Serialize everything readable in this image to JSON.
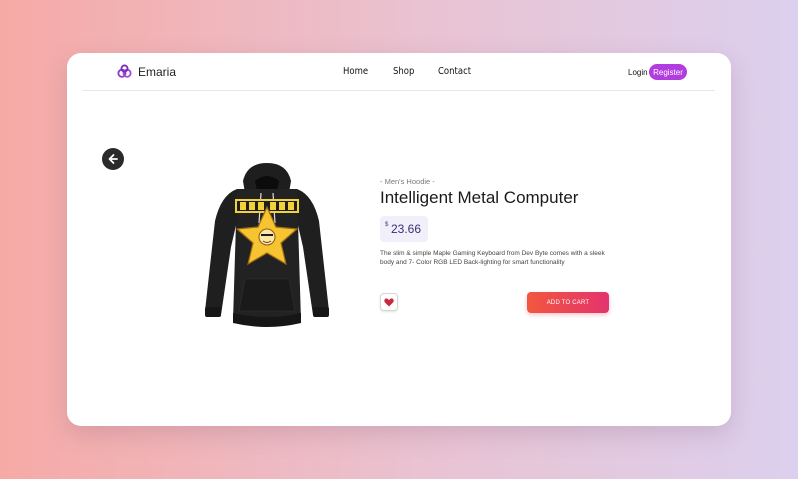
{
  "brand": {
    "name": "Emaria",
    "logo_icon": "interlocking-rings-logo",
    "logo_color": "#8e3bc8"
  },
  "nav": {
    "items": [
      {
        "label": "Home"
      },
      {
        "label": "Shop"
      },
      {
        "label": "Contact"
      }
    ]
  },
  "auth": {
    "login_label": "Login",
    "register_label": "Register",
    "register_color": "#b13cdf"
  },
  "back_button": {
    "icon": "arrow-left-icon"
  },
  "product": {
    "image": "black-hoodie-star-print",
    "category": "- Men's Hoodie -",
    "title": "Intelligent Metal Computer",
    "currency": "$",
    "price": "23.66",
    "description": "The slim & simple Maple Gaming Keyboard from Dev Byte comes with a sleek body and 7- Color RGB LED Back-lighting for smart functionality",
    "favorite_icon": "heart-icon",
    "favorite_color": "#c8283a",
    "add_to_cart_label": "ADD TO CART",
    "cart_gradient": [
      "#f2573e",
      "#e4336e"
    ]
  }
}
